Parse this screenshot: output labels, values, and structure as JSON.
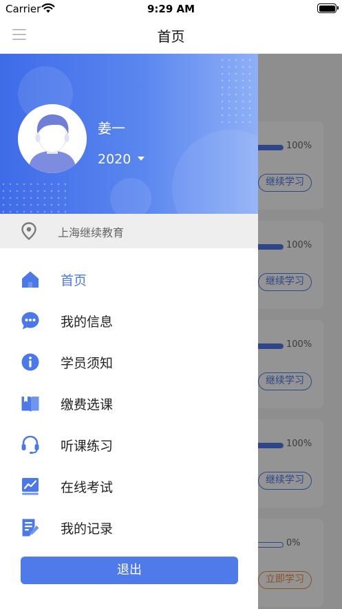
{
  "status_bar": {
    "carrier": "Carrier",
    "time": "9:29 AM"
  },
  "nav": {
    "title": "首页",
    "menu_icon": "hamburger-menu-icon"
  },
  "profile": {
    "name": "姜一",
    "year": "2020",
    "avatar_icon": "user-avatar-icon"
  },
  "location": {
    "text": "上海继续教育",
    "icon": "location-pin-icon"
  },
  "menu": {
    "items": [
      {
        "label": "首页",
        "icon": "home-icon",
        "active": true
      },
      {
        "label": "我的信息",
        "icon": "chat-bubble-icon",
        "active": false
      },
      {
        "label": "学员须知",
        "icon": "info-icon",
        "active": false
      },
      {
        "label": "缴费选课",
        "icon": "book-icon",
        "active": false
      },
      {
        "label": "听课练习",
        "icon": "headset-icon",
        "active": false
      },
      {
        "label": "在线考试",
        "icon": "chart-monitor-icon",
        "active": false
      },
      {
        "label": "我的记录",
        "icon": "document-edit-icon",
        "active": false
      }
    ]
  },
  "logout": {
    "label": "退出"
  },
  "courses": [
    {
      "progress": 1.0,
      "percent_text": "100%",
      "button": "继续学习"
    },
    {
      "progress": 1.0,
      "percent_text": "100%",
      "button": "继续学习"
    },
    {
      "progress": 1.0,
      "percent_text": "100%",
      "button": "继续学习"
    },
    {
      "progress": 1.0,
      "percent_text": "100%",
      "button": "继续学习"
    },
    {
      "progress": 0.0,
      "percent_text": "0%",
      "button": "立即学习"
    }
  ],
  "colors": {
    "accent": "#4c79e8",
    "orange": "#f08a3c",
    "header_start": "#3e6ce8",
    "header_end": "#8fb0f7"
  }
}
